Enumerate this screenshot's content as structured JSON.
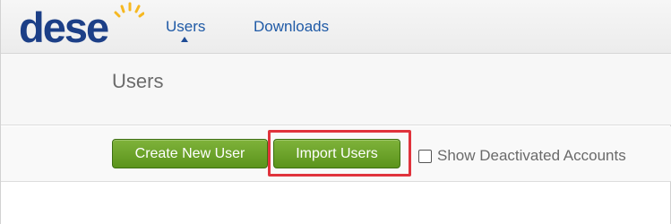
{
  "logo": {
    "text": "dese",
    "sun_color": "#f6b821",
    "text_color": "#1c3f87"
  },
  "nav": {
    "items": [
      {
        "label": "Users",
        "active": true
      },
      {
        "label": "Downloads",
        "active": false
      }
    ]
  },
  "page": {
    "title": "Users"
  },
  "toolbar": {
    "create_label": "Create New User",
    "import_label": "Import Users",
    "show_deactivated_label": "Show Deactivated Accounts",
    "show_deactivated_checked": false
  },
  "colors": {
    "nav_link": "#1f5aa6",
    "button_green": "#6aa329",
    "highlight_red": "#e0333c"
  }
}
